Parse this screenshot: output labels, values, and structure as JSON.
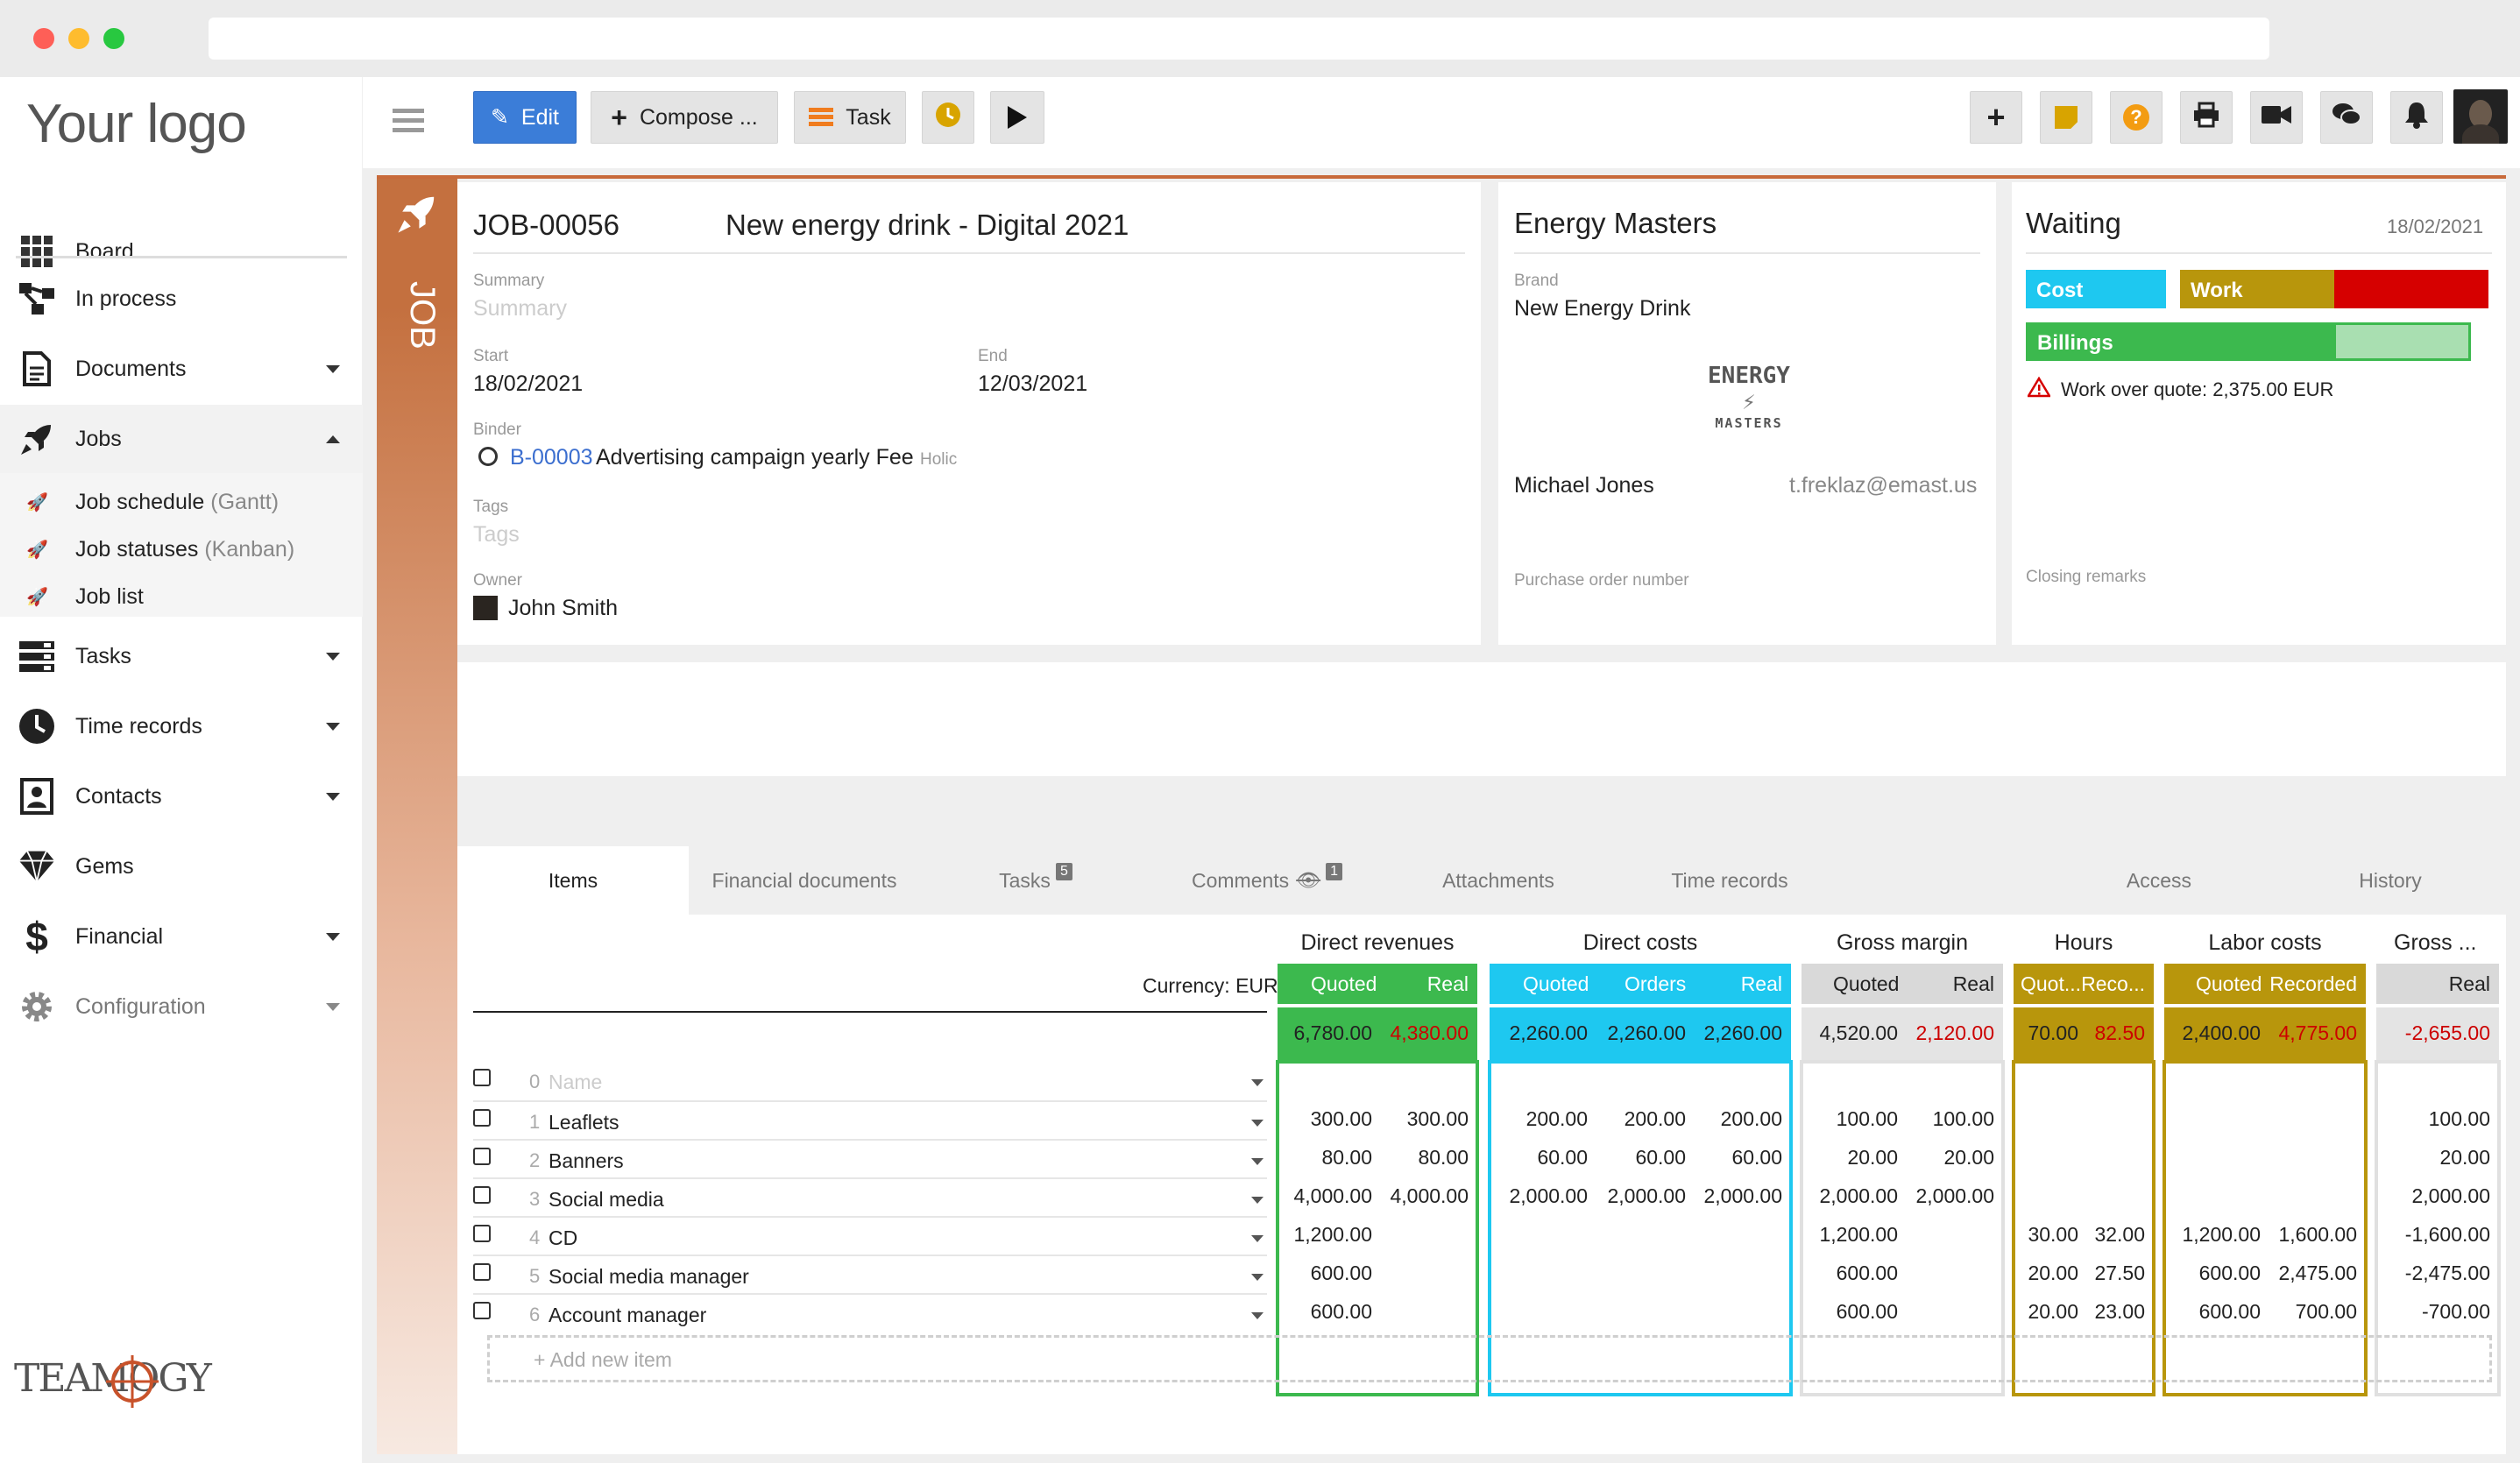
{
  "logo": "Your logo",
  "footer_logo": "TEAMOGY",
  "sidebar": {
    "items": [
      {
        "label": "Board"
      },
      {
        "label": "In process"
      },
      {
        "label": "Documents"
      },
      {
        "label": "Jobs"
      },
      {
        "label": "Tasks"
      },
      {
        "label": "Time records"
      },
      {
        "label": "Contacts"
      },
      {
        "label": "Gems"
      },
      {
        "label": "Financial"
      },
      {
        "label": "Configuration"
      }
    ],
    "jobs_sub": [
      {
        "label": "Job schedule",
        "hint": "(Gantt)"
      },
      {
        "label": "Job statuses",
        "hint": "(Kanban)"
      },
      {
        "label": "Job list",
        "hint": ""
      }
    ]
  },
  "toolbar": {
    "edit": "Edit",
    "compose": "Compose ...",
    "task": "Task"
  },
  "job": {
    "vertical_label": "JOB",
    "number": "JOB-00056",
    "title": "New energy drink - Digital 2021",
    "summary_label": "Summary",
    "summary_placeholder": "Summary",
    "start_label": "Start",
    "start": "18/02/2021",
    "end_label": "End",
    "end": "12/03/2021",
    "binder_label": "Binder",
    "binder_code": "B-00003",
    "binder_name": "Advertising campaign yearly Fee",
    "binder_extra": "Holic",
    "tags_label": "Tags",
    "tags_placeholder": "Tags",
    "owner_label": "Owner",
    "owner": "John Smith"
  },
  "client": {
    "name": "Energy Masters",
    "brand_label": "Brand",
    "brand": "New Energy Drink",
    "logo_text_top": "ENERGY",
    "logo_text_bottom": "MASTERS",
    "contact": "Michael Jones",
    "email": "t.freklaz@emast.us",
    "po_label": "Purchase order number"
  },
  "status": {
    "state": "Waiting",
    "date": "18/02/2021",
    "cost_label": "Cost",
    "work_label": "Work",
    "billings_label": "Billings",
    "billings_fill": 0.7,
    "warning": "Work over quote: 2,375.00 EUR",
    "closing_label": "Closing remarks",
    "colors": {
      "cost": "#1ec8f0",
      "work": "#b8960c",
      "work_over": "#d60000",
      "billings": "#3cb94e"
    }
  },
  "tabs": [
    {
      "label": "Items"
    },
    {
      "label": "Financial documents"
    },
    {
      "label": "Tasks",
      "badge": "5"
    },
    {
      "label": "Comments",
      "badge": "1"
    },
    {
      "label": "Attachments"
    },
    {
      "label": "Time records"
    },
    {
      "label": "Access"
    },
    {
      "label": "History"
    }
  ],
  "table": {
    "currency": "Currency: EUR",
    "groups": {
      "direct_revenues": "Direct revenues",
      "direct_costs": "Direct costs",
      "gross_margin": "Gross margin",
      "hours": "Hours",
      "labor_costs": "Labor costs",
      "gross2": "Gross ..."
    },
    "heads": {
      "dr_quoted": "Quoted",
      "dr_real": "Real",
      "dc_quoted": "Quoted",
      "dc_orders": "Orders",
      "dc_real": "Real",
      "gm_quoted": "Quoted",
      "gm_real": "Real",
      "h_quoted": "Quot...",
      "h_recorded": "Reco...",
      "lc_quoted": "Quoted",
      "lc_recorded": "Recorded",
      "g2_real": "Real"
    },
    "totals": {
      "dr_quoted": "6,780.00",
      "dr_real": "4,380.00",
      "dc_quoted": "2,260.00",
      "dc_orders": "2,260.00",
      "dc_real": "2,260.00",
      "gm_quoted": "4,520.00",
      "gm_real": "2,120.00",
      "h_quoted": "70.00",
      "h_recorded": "82.50",
      "lc_quoted": "2,400.00",
      "lc_recorded": "4,775.00",
      "g2_real": "-2,655.00"
    },
    "name_placeholder": "Name",
    "rows": [
      {
        "num": "1",
        "name": "Leaflets",
        "dr_q": "300.00",
        "dr_r": "300.00",
        "dc_q": "200.00",
        "dc_o": "200.00",
        "dc_r": "200.00",
        "gm_q": "100.00",
        "gm_r": "100.00",
        "h_q": "",
        "h_r": "",
        "lc_q": "",
        "lc_r": "",
        "g2": "100.00"
      },
      {
        "num": "2",
        "name": "Banners",
        "dr_q": "80.00",
        "dr_r": "80.00",
        "dc_q": "60.00",
        "dc_o": "60.00",
        "dc_r": "60.00",
        "gm_q": "20.00",
        "gm_r": "20.00",
        "h_q": "",
        "h_r": "",
        "lc_q": "",
        "lc_r": "",
        "g2": "20.00"
      },
      {
        "num": "3",
        "name": "Social media",
        "dr_q": "4,000.00",
        "dr_r": "4,000.00",
        "dc_q": "2,000.00",
        "dc_o": "2,000.00",
        "dc_r": "2,000.00",
        "gm_q": "2,000.00",
        "gm_r": "2,000.00",
        "h_q": "",
        "h_r": "",
        "lc_q": "",
        "lc_r": "",
        "g2": "2,000.00"
      },
      {
        "num": "4",
        "name": "CD",
        "dr_q": "1,200.00",
        "dr_r": "",
        "dc_q": "",
        "dc_o": "",
        "dc_r": "",
        "gm_q": "1,200.00",
        "gm_r": "",
        "h_q": "30.00",
        "h_r": "32.00",
        "lc_q": "1,200.00",
        "lc_r": "1,600.00",
        "g2": "-1,600.00"
      },
      {
        "num": "5",
        "name": "Social media manager",
        "dr_q": "600.00",
        "dr_r": "",
        "dc_q": "",
        "dc_o": "",
        "dc_r": "",
        "gm_q": "600.00",
        "gm_r": "",
        "h_q": "20.00",
        "h_r": "27.50",
        "lc_q": "600.00",
        "lc_r": "2,475.00",
        "g2": "-2,475.00"
      },
      {
        "num": "6",
        "name": "Account manager",
        "dr_q": "600.00",
        "dr_r": "",
        "dc_q": "",
        "dc_o": "",
        "dc_r": "",
        "gm_q": "600.00",
        "gm_r": "",
        "h_q": "20.00",
        "h_r": "23.00",
        "lc_q": "600.00",
        "lc_r": "700.00",
        "g2": "-700.00"
      }
    ],
    "add_new": "Add new item",
    "colors": {
      "revenues": "#3cb94e",
      "costs": "#1ec8f0",
      "margin": "#d9d9d9",
      "hours": "#b8960c",
      "labor": "#b8960c",
      "gross2": "#d9d9d9"
    }
  }
}
